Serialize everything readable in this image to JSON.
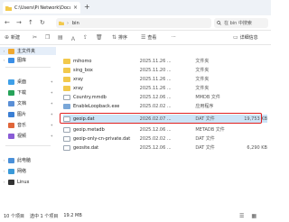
{
  "window": {
    "tab_title": "C:\\Users\\Pi Network\\Docume",
    "tab_close": "×",
    "new_tab": "+"
  },
  "address_bar": {
    "back": "←",
    "forward": "→",
    "up": "↑",
    "refresh": "↻",
    "breadcrumb": "bin",
    "search_placeholder": "在 bin 中搜索"
  },
  "command_bar": {
    "new_label": "新建",
    "sort_label": "排序",
    "view_label": "查看",
    "more": "···",
    "details_label": "详细信息"
  },
  "sidebar": {
    "items": [
      {
        "label": "主文件夹",
        "icon": "home-icon",
        "active": true
      },
      {
        "label": "图库",
        "icon": "gallery-icon",
        "active": false
      },
      {
        "label": "桌面",
        "icon": "desktop-icon",
        "active": false
      },
      {
        "label": "下载",
        "icon": "download-icon",
        "active": false
      },
      {
        "label": "文档",
        "icon": "documents-icon",
        "active": false
      },
      {
        "label": "图片",
        "icon": "pictures-icon",
        "active": false
      },
      {
        "label": "音乐",
        "icon": "music-icon",
        "active": false
      },
      {
        "label": "视频",
        "icon": "videos-icon",
        "active": false
      },
      {
        "label": "此电脑",
        "icon": "this-pc-icon",
        "active": false
      },
      {
        "label": "网络",
        "icon": "network-icon",
        "active": false
      },
      {
        "label": "Linux",
        "icon": "linux-icon",
        "active": false
      }
    ]
  },
  "files": [
    {
      "name": "mihomo",
      "date": "2025.11.26 ...",
      "type": "文件夹",
      "size": "",
      "kind": "folder",
      "selected": false
    },
    {
      "name": "sing_box",
      "date": "2025.11.20 ...",
      "type": "文件夹",
      "size": "",
      "kind": "folder",
      "selected": false
    },
    {
      "name": "xray",
      "date": "2025.11.26 ...",
      "type": "文件夹",
      "size": "",
      "kind": "folder",
      "selected": false
    },
    {
      "name": "xray",
      "date": "2025.11.26 ...",
      "type": "文件夹",
      "size": "",
      "kind": "folder",
      "selected": false
    },
    {
      "name": "Country.mmdb",
      "date": "2025.12.06 ...",
      "type": "MMDB 文件",
      "size": "",
      "kind": "file",
      "selected": false
    },
    {
      "name": "EnableLoopback.exe",
      "date": "2025.02.02 ...",
      "type": "应用程序",
      "size": "",
      "kind": "file",
      "selected": false
    },
    {
      "name": "geoip.dat",
      "date": "2026.02.07 ...",
      "type": "DAT 文件",
      "size": "19,753 KB",
      "kind": "file",
      "selected": true
    },
    {
      "name": "geoip.metadb",
      "date": "2025.12.06 ...",
      "type": "METADB 文件",
      "size": "",
      "kind": "file",
      "selected": false
    },
    {
      "name": "geoip-only-cn-private.dat",
      "date": "2025.02.02 ...",
      "type": "DAT 文件",
      "size": "",
      "kind": "file",
      "selected": false
    },
    {
      "name": "geosite.dat",
      "date": "2025.12.06 ...",
      "type": "DAT 文件",
      "size": "6,290 KB",
      "kind": "file",
      "selected": false
    }
  ],
  "status_bar": {
    "count": "10 个项目",
    "selected": "选中 1 个项目",
    "size": "19.2 MB"
  },
  "colors": {
    "highlight": "#e02020",
    "selection": "#cce4f7",
    "folder": "#f2c94c"
  }
}
